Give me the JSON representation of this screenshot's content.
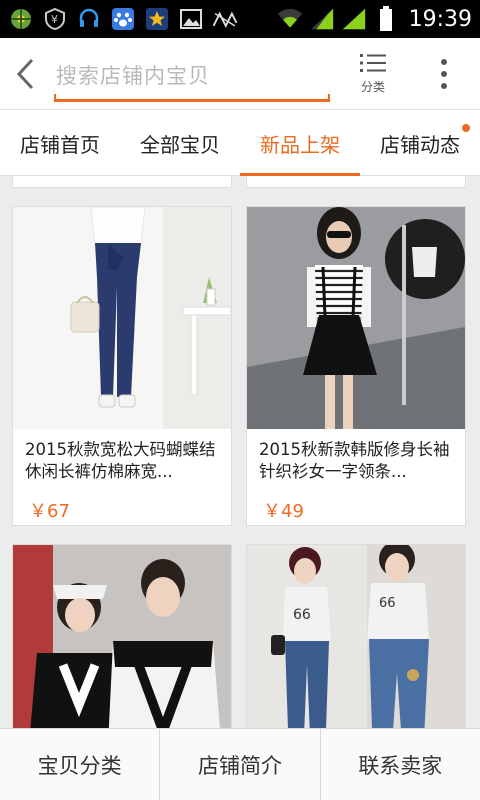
{
  "status_bar": {
    "time": "19:39",
    "icons": [
      "wheel-app-icon",
      "shield-icon",
      "headset-icon",
      "paw-app-icon",
      "star-app-icon",
      "image-icon",
      "signal-off-icon",
      "wifi-icon",
      "cell-signal-icon",
      "cell-signal-icon",
      "battery-icon"
    ]
  },
  "top_bar": {
    "search_placeholder": "搜索店铺内宝贝",
    "category_label": "分类"
  },
  "tabs": [
    {
      "label": "店铺首页",
      "active": false
    },
    {
      "label": "全部宝贝",
      "active": false
    },
    {
      "label": "新品上架",
      "active": true
    },
    {
      "label": "店铺动态",
      "active": false,
      "has_dot": true
    }
  ],
  "products": [
    {
      "title": "2015秋款宽松大码蝴蝶结休闲长裤仿棉麻宽...",
      "price": "￥67"
    },
    {
      "title": "2015秋新款韩版修身长袖针织衫女一字领条...",
      "price": "￥49"
    },
    {
      "title": "",
      "price": ""
    },
    {
      "title": "",
      "price": ""
    }
  ],
  "bottom_bar": {
    "items": [
      "宝贝分类",
      "店铺简介",
      "联系卖家"
    ]
  },
  "colors": {
    "accent": "#f06a22",
    "text": "#222222",
    "placeholder": "#b9b9b9"
  }
}
